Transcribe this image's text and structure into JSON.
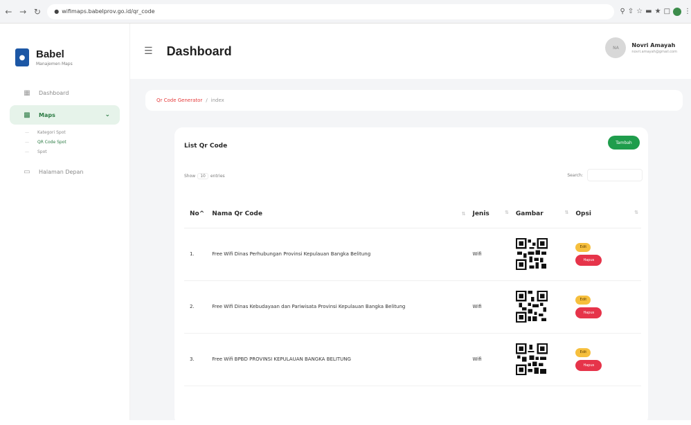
{
  "browser": {
    "url": "wifimaps.babelprov.go.id/qr_code",
    "icons": [
      "back-icon",
      "forward-icon",
      "reload-icon",
      "lock-icon",
      "zoom-icon",
      "share-icon",
      "star-icon",
      "extensions-icon",
      "pin-icon",
      "window-icon",
      "profile-icon",
      "menu-icon"
    ]
  },
  "brand": {
    "title": "Babel",
    "subtitle": "Manajemen Maps",
    "logo_color": "#1c57a5"
  },
  "sidebar": {
    "items": [
      {
        "label": "Dashboard",
        "icon": "grid-icon"
      },
      {
        "label": "Maps",
        "icon": "map-icon",
        "active": true,
        "submenu": [
          {
            "label": "Kategori Spot"
          },
          {
            "label": "QR Code Spot",
            "current": true
          },
          {
            "label": "Spot"
          }
        ]
      },
      {
        "label": "Halaman Depan",
        "icon": "monitor-icon"
      }
    ]
  },
  "topbar": {
    "title": "Dashboard",
    "user_name": "Novri Amayah",
    "user_email": "novri.amayah@gmail.com",
    "avatar_text": "NA"
  },
  "breadcrumb": {
    "link": "Qr Code Generator",
    "separator": "/",
    "current": "index"
  },
  "card": {
    "title": "List Qr Code",
    "add_button": "Tambah",
    "show_label": "Show",
    "show_value": "10",
    "entries_label": "entries",
    "search_label": "Search:"
  },
  "table": {
    "headers": [
      "No",
      "Nama Qr Code",
      "Jenis",
      "Gambar",
      "Opsi"
    ],
    "rows": [
      {
        "no": "1.",
        "name": "Free Wifi Dinas Perhubungan Provinsi Kepulauan Bangka Belitung",
        "jenis": "Wifi"
      },
      {
        "no": "2.",
        "name": "Free Wifi Dinas Kebudayaan dan Pariwisata Provinsi Kepulauan Bangka Belitung",
        "jenis": "Wifi"
      },
      {
        "no": "3.",
        "name": "Free Wifi BPBD PROVINSI KEPULAUAN BANGKA BELITUNG",
        "jenis": "Wifi"
      }
    ],
    "edit_label": "Edit",
    "delete_label": "Hapus"
  },
  "colors": {
    "accent_green": "#1f9d4c",
    "active_menu_bg": "#e6f3ea",
    "breadcrumb_link": "#e53b3b",
    "edit_yellow": "#f6bf3d",
    "delete_red": "#e6344a"
  }
}
